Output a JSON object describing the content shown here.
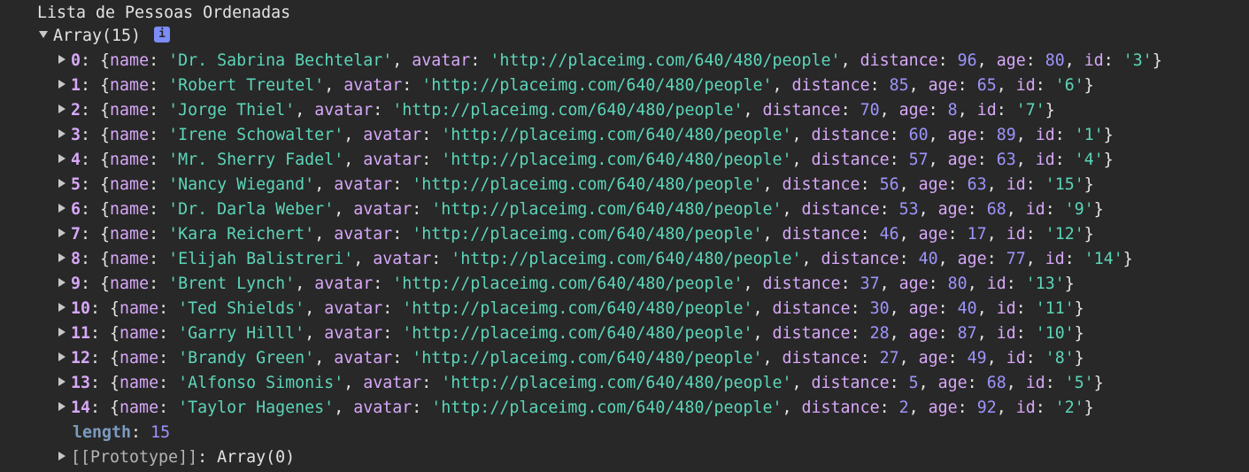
{
  "console": {
    "log_label": "Lista de Pessoas Ordenadas",
    "array_summary": "Array(15)",
    "info_icon": "i",
    "length_key": "length",
    "length_value": "15",
    "prototype_key": "[[Prototype]]",
    "prototype_value": "Array(0)",
    "keys": {
      "name": "name",
      "avatar": "avatar",
      "distance": "distance",
      "age": "age",
      "id": "id"
    },
    "items": [
      {
        "index": "0",
        "name": "'Dr. Sabrina Bechtelar'",
        "avatar": "'http://placeimg.com/640/480/people'",
        "distance": "96",
        "age": "80",
        "id": "'3'"
      },
      {
        "index": "1",
        "name": "'Robert Treutel'",
        "avatar": "'http://placeimg.com/640/480/people'",
        "distance": "85",
        "age": "65",
        "id": "'6'"
      },
      {
        "index": "2",
        "name": "'Jorge Thiel'",
        "avatar": "'http://placeimg.com/640/480/people'",
        "distance": "70",
        "age": "8",
        "id": "'7'"
      },
      {
        "index": "3",
        "name": "'Irene Schowalter'",
        "avatar": "'http://placeimg.com/640/480/people'",
        "distance": "60",
        "age": "89",
        "id": "'1'"
      },
      {
        "index": "4",
        "name": "'Mr. Sherry Fadel'",
        "avatar": "'http://placeimg.com/640/480/people'",
        "distance": "57",
        "age": "63",
        "id": "'4'"
      },
      {
        "index": "5",
        "name": "'Nancy Wiegand'",
        "avatar": "'http://placeimg.com/640/480/people'",
        "distance": "56",
        "age": "63",
        "id": "'15'"
      },
      {
        "index": "6",
        "name": "'Dr. Darla Weber'",
        "avatar": "'http://placeimg.com/640/480/people'",
        "distance": "53",
        "age": "68",
        "id": "'9'"
      },
      {
        "index": "7",
        "name": "'Kara Reichert'",
        "avatar": "'http://placeimg.com/640/480/people'",
        "distance": "46",
        "age": "17",
        "id": "'12'"
      },
      {
        "index": "8",
        "name": "'Elijah Balistreri'",
        "avatar": "'http://placeimg.com/640/480/people'",
        "distance": "40",
        "age": "77",
        "id": "'14'"
      },
      {
        "index": "9",
        "name": "'Brent Lynch'",
        "avatar": "'http://placeimg.com/640/480/people'",
        "distance": "37",
        "age": "80",
        "id": "'13'"
      },
      {
        "index": "10",
        "name": "'Ted Shields'",
        "avatar": "'http://placeimg.com/640/480/people'",
        "distance": "30",
        "age": "40",
        "id": "'11'"
      },
      {
        "index": "11",
        "name": "'Garry Hilll'",
        "avatar": "'http://placeimg.com/640/480/people'",
        "distance": "28",
        "age": "87",
        "id": "'10'"
      },
      {
        "index": "12",
        "name": "'Brandy Green'",
        "avatar": "'http://placeimg.com/640/480/people'",
        "distance": "27",
        "age": "49",
        "id": "'8'"
      },
      {
        "index": "13",
        "name": "'Alfonso Simonis'",
        "avatar": "'http://placeimg.com/640/480/people'",
        "distance": "5",
        "age": "68",
        "id": "'5'"
      },
      {
        "index": "14",
        "name": "'Taylor Hagenes'",
        "avatar": "'http://placeimg.com/640/480/people'",
        "distance": "2",
        "age": "92",
        "id": "'2'"
      }
    ],
    "colors": {
      "background": "#282828",
      "key": "#d7a8f8",
      "string": "#5cd5b8",
      "number": "#9d94fc",
      "text": "#e3e3e3"
    }
  }
}
